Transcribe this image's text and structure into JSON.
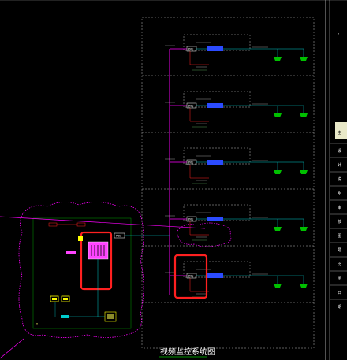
{
  "diagram": {
    "title": "视频监控系统图",
    "floors": [
      {
        "id": "floor-1",
        "switch_label": "POE",
        "has_highlight": false
      },
      {
        "id": "floor-2",
        "switch_label": "POE",
        "has_highlight": false
      },
      {
        "id": "floor-3",
        "switch_label": "POE",
        "has_highlight": false
      },
      {
        "id": "floor-4",
        "switch_label": "POE",
        "has_highlight": false
      },
      {
        "id": "floor-5",
        "switch_label": "POE",
        "has_highlight": true
      }
    ],
    "control_room": {
      "main_switch_label": "POE",
      "highlighted": true
    },
    "colors": {
      "background": "#000000",
      "trunk": "#ff00ff",
      "camera": "#00c000",
      "switch": "#2b4bff",
      "highlight": "#ff2020",
      "cable": "#00cccc",
      "frame": "#bbbbbb",
      "yellow": "#ffff00"
    }
  },
  "side_panel": {
    "badge": "主",
    "rows": [
      "设",
      "计",
      "说",
      "明",
      "审",
      "核",
      "图",
      "号",
      "比",
      "例",
      "日",
      "期"
    ]
  },
  "markers": {
    "top_right_marker": "□"
  }
}
